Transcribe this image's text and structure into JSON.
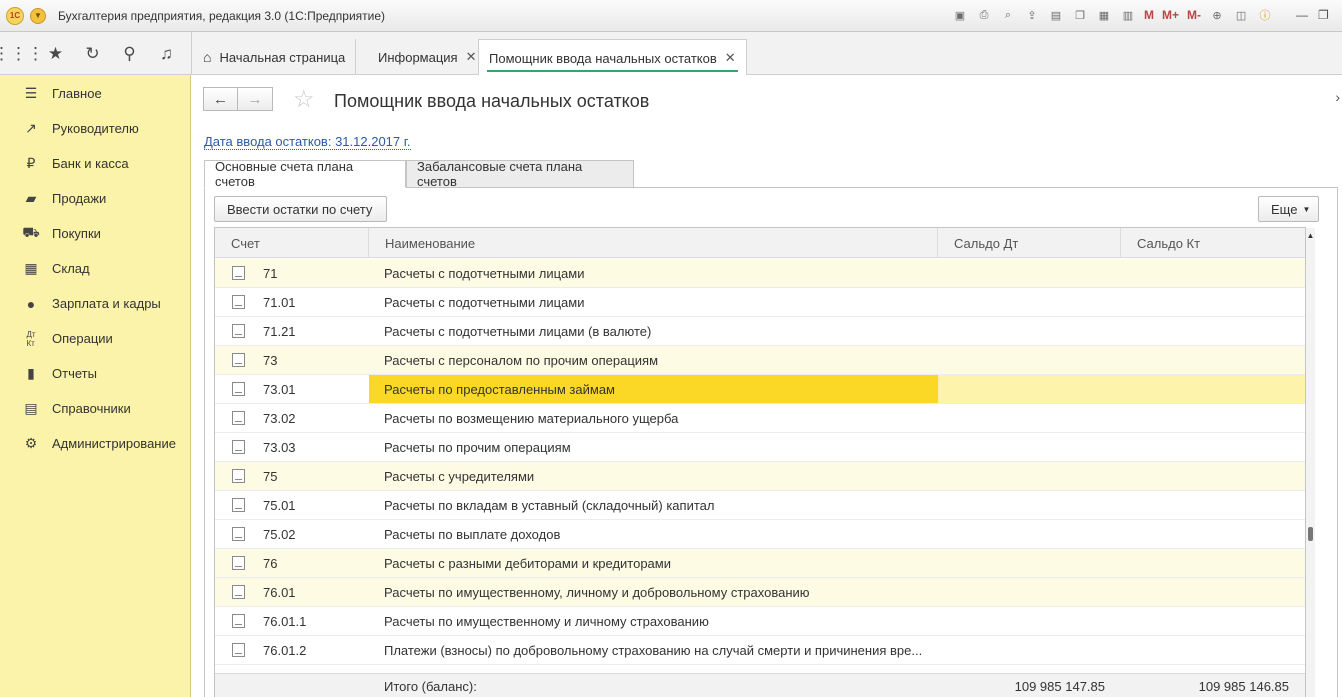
{
  "titlebar": {
    "logo": "1С",
    "title": "Бухгалтерия предприятия, редакция 3.0 (1С:Предприятие)",
    "toolbar_labels": [
      "M",
      "M+",
      "M-"
    ]
  },
  "tabs": [
    {
      "label": "Начальная страница"
    },
    {
      "label": "Информация"
    },
    {
      "label": "Помощник ввода начальных остатков"
    }
  ],
  "sidebar": {
    "items": [
      {
        "label": "Главное",
        "icon": "menu-icon"
      },
      {
        "label": "Руководителю",
        "icon": "trend-icon"
      },
      {
        "label": "Банк и касса",
        "icon": "ruble-icon"
      },
      {
        "label": "Продажи",
        "icon": "bag-icon"
      },
      {
        "label": "Покупки",
        "icon": "cart-icon"
      },
      {
        "label": "Склад",
        "icon": "warehouse-icon"
      },
      {
        "label": "Зарплата и кадры",
        "icon": "person-icon"
      },
      {
        "label": "Операции",
        "icon": "dtkt-icon"
      },
      {
        "label": "Отчеты",
        "icon": "bar-chart-icon"
      },
      {
        "label": "Справочники",
        "icon": "books-icon"
      },
      {
        "label": "Администрирование",
        "icon": "gear-icon"
      }
    ]
  },
  "form": {
    "title": "Помощник ввода начальных остатков",
    "date_link": "Дата ввода остатков: 31.12.2017 г.",
    "tabs": [
      {
        "label": "Основные счета плана счетов"
      },
      {
        "label": "Забалансовые счета плана счетов"
      }
    ],
    "enter_button": "Ввести остатки по счету",
    "more_button": "Еще"
  },
  "table": {
    "columns": [
      "Счет",
      "Наименование",
      "Сальдо Дт",
      "Сальдо Кт"
    ],
    "rows": [
      {
        "code": "71",
        "name": "Расчеты с подотчетными лицами",
        "group": true
      },
      {
        "code": "71.01",
        "name": "Расчеты с подотчетными лицами",
        "group": false
      },
      {
        "code": "71.21",
        "name": "Расчеты с подотчетными лицами (в валюте)",
        "group": false
      },
      {
        "code": "73",
        "name": "Расчеты с персоналом по прочим операциям",
        "group": true
      },
      {
        "code": "73.01",
        "name": "Расчеты по предоставленным займам",
        "group": false,
        "selected": true
      },
      {
        "code": "73.02",
        "name": "Расчеты по возмещению материального ущерба",
        "group": false
      },
      {
        "code": "73.03",
        "name": "Расчеты по прочим операциям",
        "group": false
      },
      {
        "code": "75",
        "name": "Расчеты с учредителями",
        "group": true
      },
      {
        "code": "75.01",
        "name": "Расчеты по вкладам в уставный (складочный) капитал",
        "group": false
      },
      {
        "code": "75.02",
        "name": "Расчеты по выплате доходов",
        "group": false
      },
      {
        "code": "76",
        "name": "Расчеты с разными дебиторами и кредиторами",
        "group": true
      },
      {
        "code": "76.01",
        "name": "Расчеты по имущественному, личному и добровольному страхованию",
        "group": true
      },
      {
        "code": "76.01.1",
        "name": "Расчеты по имущественному и личному страхованию",
        "group": false
      },
      {
        "code": "76.01.2",
        "name": "Платежи (взносы) по добровольному страхованию на случай смерти и причинения вре...",
        "group": false
      }
    ],
    "footer": {
      "label": "Итого (баланс):",
      "debit": "109 985 147.85",
      "credit": "109 985 146.85"
    }
  },
  "colors": {
    "sidebar_bg": "#fbf3aa",
    "selection": "#fcd826",
    "group_row": "#fefbe4",
    "link": "#2a5aa8"
  }
}
